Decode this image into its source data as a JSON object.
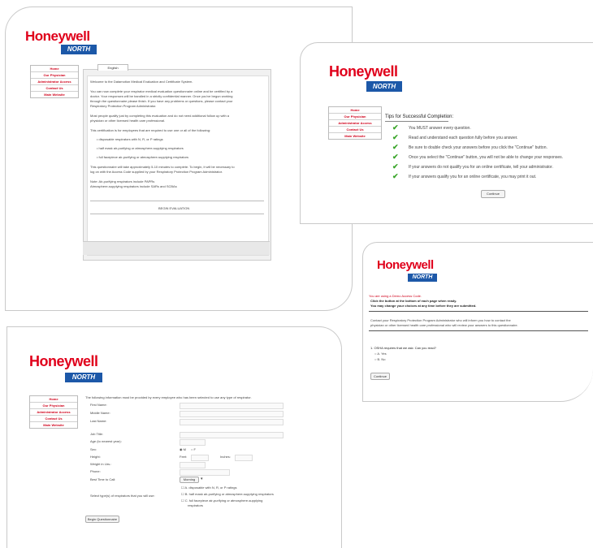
{
  "brand": {
    "name": "Honeywell",
    "sub": "NORTH"
  },
  "nav": [
    "Home",
    "Our Physician",
    "Administrator Access",
    "Contact Us",
    "Main Website"
  ],
  "screen1": {
    "tab": "English",
    "paragraphs": [
      "Welcome to the Datamotion Medical Evaluation and Certificate System.",
      "You can now complete your respirator medical evaluation questionnaire online and be certified by a",
      "doctor. Your responses will be handled in a strictly confidential manner. Once you've begun working",
      "through the questionnaire please finish. If you have any problems or questions, please contact your",
      "Respiratory Protection Program Administrator.",
      "Most people qualify just by completing this evaluation and do not need additional follow up with a",
      "physician or other licensed health care professional.",
      "This certification is for employees that are required to use one or all of the following:",
      "• disposable respirators with N, R, or P ratings",
      "• half mask air-purifying or atmosphere-supplying respirators",
      "• full facepiece air-purifying or atmosphere-supplying respirators",
      "This questionnaire will take approximately 5-10 minutes to complete. To begin, it will be necessary to",
      "log on with the Access Code supplied by your Respiratory Protection Program Administrator.",
      "Note: Air-purifying respirators include PAPRs",
      "Atmosphere-supplying respirators include SARs and SCBAs"
    ],
    "button": "BEGIN EVALUATION"
  },
  "screen2": {
    "title": "Tips for Successful Completion:",
    "tips": [
      "You MUST answer every question.",
      "Read and understand each question fully before you answer.",
      "Be sure to double check your answers before you click the \"Continue\" button.",
      "Once you select the \"Continue\" button, you will not be able to change your responses.",
      "If your answers do not qualify you for an online certificate, tell your administrator.",
      "If your answers qualify you for an online certificate, you may print it out."
    ],
    "button": "Continue"
  },
  "screen3": {
    "notice": "You are using a Demo Access Code.",
    "lines": [
      "Click the button at the bottom of each page when ready.",
      "You may change your choices at any time before they are submitted."
    ],
    "para": [
      "Contact your Respiratory Protection Program Administrator who will inform you how to contact the",
      "physician or other licensed health care professional who will review your answers to this questionnaire."
    ],
    "question": "1. OSHA requires that we ask: Can you read?",
    "options": [
      "A. Yes",
      "B. No"
    ],
    "button": "Continue"
  },
  "screen4": {
    "intro": "The following information must be provided by every employee who has been selected to use any type of respirator.",
    "fields": [
      "First Name:",
      "Middle Name:",
      "Last Name:",
      "Job Title:",
      "Age (to nearest year):",
      "Sex:",
      "Height:",
      "Weight in Lbs.:",
      "Phone:",
      "Best Time to Call:"
    ],
    "sex": [
      "M",
      "F"
    ],
    "height": [
      "Feet:",
      "Inches:"
    ],
    "best_time": "Morning",
    "resp_label": "Select type(s) of respirators that you will use:",
    "resp_options": [
      "A. disposable with N, R, or P ratings",
      "B. half mask air-purifying or atmosphere-supplying respirators",
      "C. full facepiece air-purifying or atmosphere-supplying",
      "respirators"
    ],
    "button": "Begin Questionnaire"
  }
}
